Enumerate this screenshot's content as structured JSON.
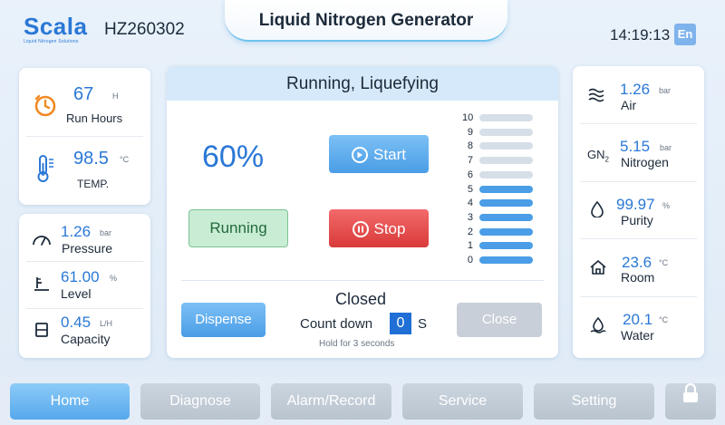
{
  "header": {
    "logo_text": "Scala",
    "logo_subtext": "Liquid Nitrogen Solutions",
    "model": "HZ260302",
    "title": "Liquid Nitrogen Generator",
    "time": "14:19:13",
    "lang": "En"
  },
  "left_top": {
    "run_hours": {
      "value": "67",
      "unit": "H",
      "label": "Run Hours",
      "icon": "clock-icon"
    },
    "temp": {
      "value": "98.5",
      "unit": "°C",
      "label": "TEMP.",
      "icon": "thermometer-icon"
    }
  },
  "left_bottom": {
    "pressure": {
      "value": "1.26",
      "unit": "bar",
      "label": "Pressure",
      "icon": "gauge-icon"
    },
    "level": {
      "value": "61.00",
      "unit": "%",
      "label": "Level",
      "icon": "level-icon"
    },
    "capacity": {
      "value": "0.45",
      "unit": "L/H",
      "label": "Capacity",
      "icon": "container-icon"
    }
  },
  "center": {
    "status_title": "Running, Liquefying",
    "percent": "60%",
    "start_label": "Start",
    "stop_label": "Stop",
    "running_label": "Running",
    "level_scale": [
      "10",
      "9",
      "8",
      "7",
      "6",
      "5",
      "4",
      "3",
      "2",
      "1",
      "0"
    ],
    "level_filled": 6,
    "colors": {
      "filled": "#4a9de6",
      "empty": "#d6dee7"
    },
    "dispense_label": "Dispense",
    "valve_state": "Closed",
    "countdown_label": "Count down",
    "countdown_value": "0",
    "countdown_unit": "S",
    "hold_text": "Hold for 3 seconds",
    "close_label": "Close"
  },
  "right": {
    "air": {
      "value": "1.26",
      "unit": "bar",
      "label": "Air",
      "icon": "wave-icon"
    },
    "nitrogen": {
      "value": "5.15",
      "unit": "bar",
      "label": "Nitrogen",
      "icon": "gn2-icon",
      "icon_text": "GN",
      "icon_sub": "2"
    },
    "purity": {
      "value": "99.97",
      "unit": "%",
      "label": "Purity",
      "icon": "drop-icon"
    },
    "room": {
      "value": "23.6",
      "unit": "°C",
      "label": "Room",
      "icon": "house-icon"
    },
    "water": {
      "value": "20.1",
      "unit": "°C",
      "label": "Water",
      "icon": "water-temp-icon"
    }
  },
  "nav": {
    "home": "Home",
    "diagnose": "Diagnose",
    "alarm": "Alarm/Record",
    "service": "Service",
    "setting": "Setting",
    "lock_icon": "lock-icon"
  }
}
